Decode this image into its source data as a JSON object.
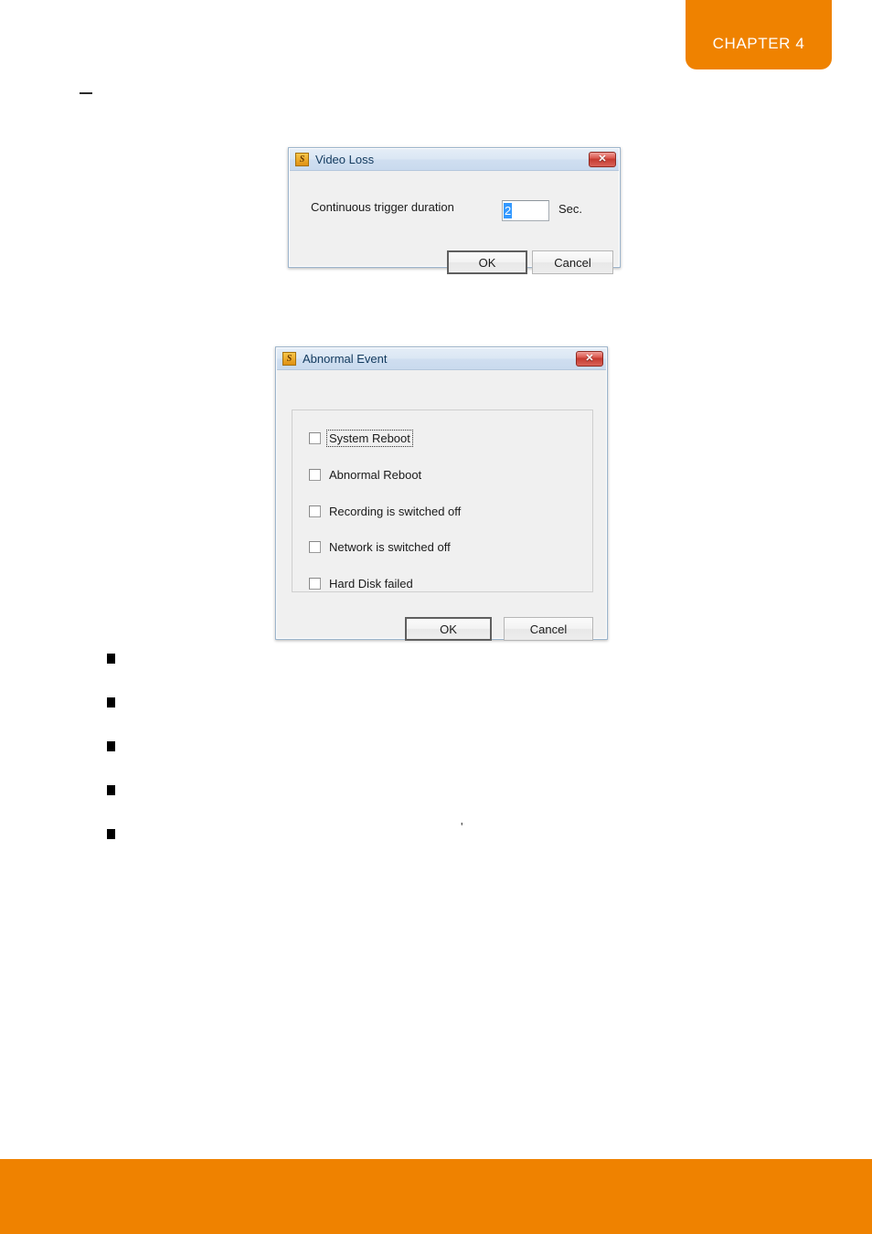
{
  "page": {
    "chapter_tab_label": "CHAPTER 4",
    "accent_color": "#ef8200",
    "top_dash": "",
    "stray_mark": "'"
  },
  "bullets": [
    {
      "marker": "square",
      "text": ""
    },
    {
      "marker": "square",
      "text": ""
    },
    {
      "marker": "square",
      "text": ""
    },
    {
      "marker": "square",
      "text": ""
    },
    {
      "marker": "square",
      "text": ""
    }
  ],
  "dialogs": {
    "video_loss": {
      "title": "Video Loss",
      "icon": "app-window-icon",
      "icon_glyph": "S",
      "close_glyph": "✕",
      "field_label": "Continuous trigger duration",
      "field_value": "2",
      "field_unit": "Sec.",
      "selection_color": "#3399ff",
      "ok_label": "OK",
      "cancel_label": "Cancel"
    },
    "abnormal_event": {
      "title": "Abnormal Event",
      "icon": "app-window-icon",
      "icon_glyph": "S",
      "close_glyph": "✕",
      "checkboxes": [
        {
          "label": "System Reboot",
          "checked": false,
          "focused": true
        },
        {
          "label": "Abnormal Reboot",
          "checked": false,
          "focused": false
        },
        {
          "label": "Recording is switched off",
          "checked": false,
          "focused": false
        },
        {
          "label": "Network is switched off",
          "checked": false,
          "focused": false
        },
        {
          "label": "Hard Disk failed",
          "checked": false,
          "focused": false
        }
      ],
      "ok_label": "OK",
      "cancel_label": "Cancel"
    }
  }
}
